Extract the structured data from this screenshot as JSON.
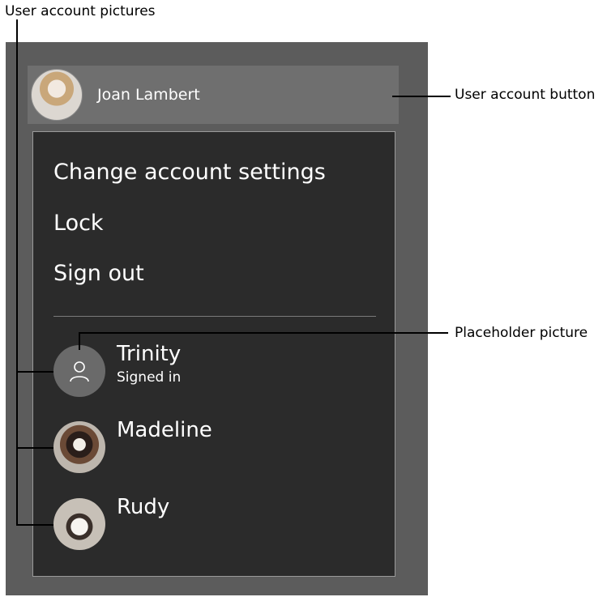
{
  "callouts": {
    "user_account_pictures": "User account pictures",
    "user_account_button": "User account button",
    "placeholder_picture": "Placeholder picture"
  },
  "account_button": {
    "name": "Joan Lambert"
  },
  "menu": {
    "items": [
      {
        "label": "Change account settings"
      },
      {
        "label": "Lock"
      },
      {
        "label": "Sign out"
      }
    ]
  },
  "users": [
    {
      "name": "Trinity",
      "status": "Signed in",
      "icon": "person-icon"
    },
    {
      "name": "Madeline",
      "status": "",
      "icon": "dog-photo"
    },
    {
      "name": "Rudy",
      "status": "",
      "icon": "dog-photo"
    }
  ],
  "colors": {
    "frame": "#5c5c5c",
    "account_button": "#6f6f6f",
    "menu_bg": "#2b2b2b",
    "text": "#ffffff"
  }
}
